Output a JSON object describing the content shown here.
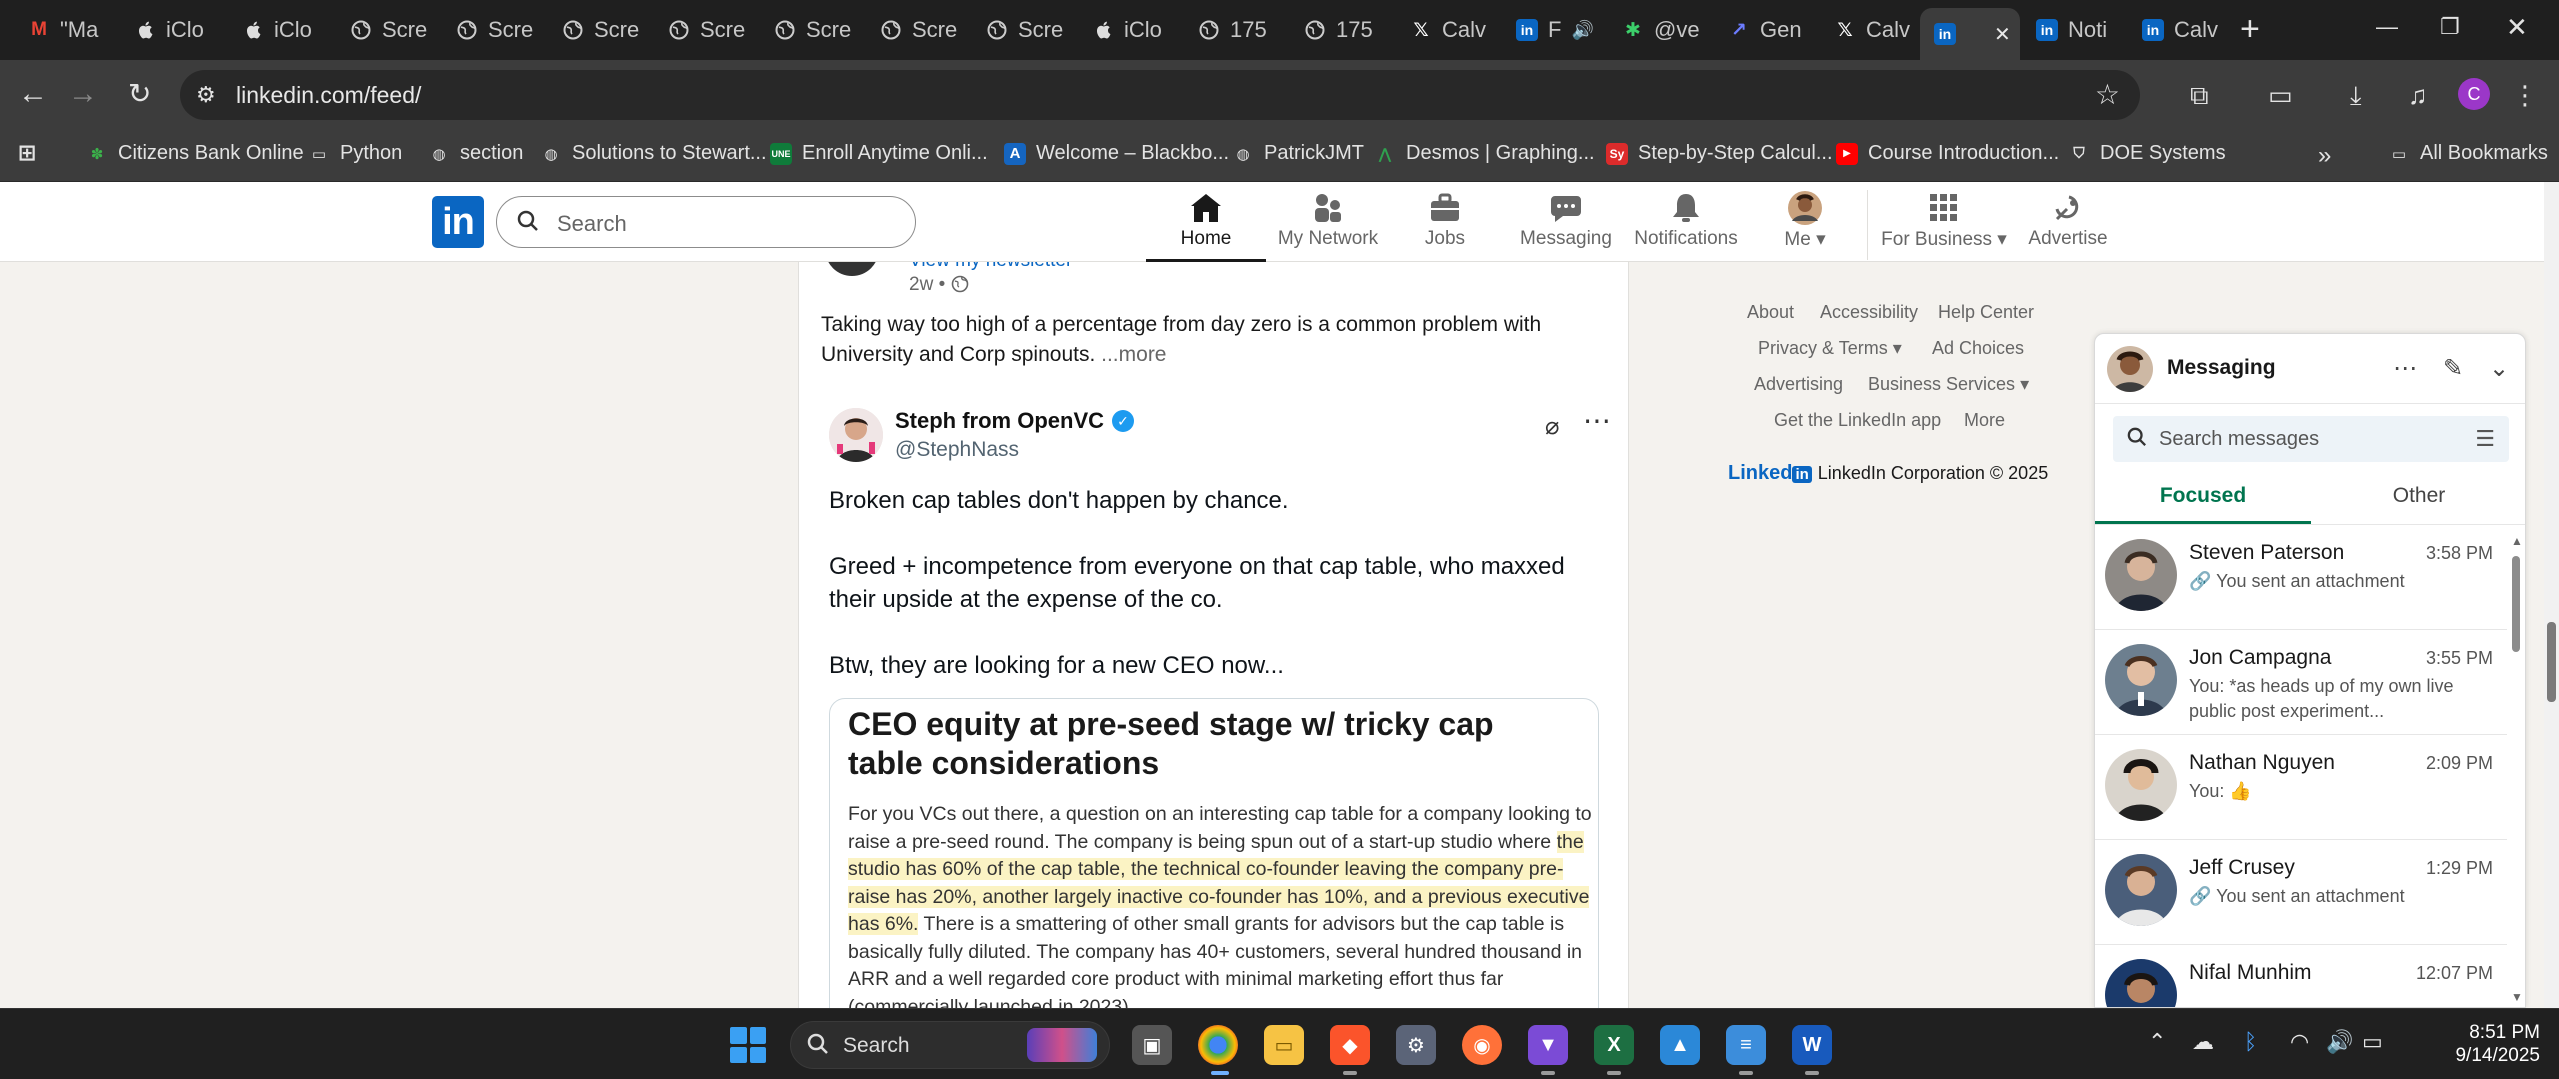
{
  "browser": {
    "tabs": [
      {
        "label": "\"Ma",
        "icon": "gmail-icon"
      },
      {
        "label": "iClo",
        "icon": "apple-icon"
      },
      {
        "label": "iClo",
        "icon": "apple-icon"
      },
      {
        "label": "Scre",
        "icon": "globe-icon"
      },
      {
        "label": "Scre",
        "icon": "globe-icon"
      },
      {
        "label": "Scre",
        "icon": "globe-icon"
      },
      {
        "label": "Scre",
        "icon": "globe-icon"
      },
      {
        "label": "Scre",
        "icon": "globe-icon"
      },
      {
        "label": "Scre",
        "icon": "globe-icon"
      },
      {
        "label": "Scre",
        "icon": "globe-icon"
      },
      {
        "label": "iClo",
        "icon": "apple-icon"
      },
      {
        "label": "175",
        "icon": "globe-icon"
      },
      {
        "label": "175",
        "icon": "globe-icon"
      },
      {
        "label": "Calv",
        "icon": "x-icon"
      },
      {
        "label": "F",
        "icon": "linkedin-icon"
      },
      {
        "label": "@ve",
        "icon": "perplexity-icon"
      },
      {
        "label": "Gen",
        "icon": "arrow-icon"
      },
      {
        "label": "Calv",
        "icon": "x-icon"
      },
      {
        "label": "",
        "icon": "linkedin-icon",
        "active": true
      },
      {
        "label": "Noti",
        "icon": "linkedin-icon"
      },
      {
        "label": "Calv",
        "icon": "linkedin-icon"
      }
    ],
    "url": "linkedin.com/feed/",
    "bookmarks": [
      "Citizens Bank Online",
      "Python",
      "section",
      "Solutions to Stewart...",
      "Enroll Anytime Onli...",
      "Welcome – Blackbo...",
      "PatrickJMT",
      "Desmos | Graphing...",
      "Step-by-Step Calcul...",
      "Course Introduction...",
      "DOE Systems"
    ],
    "all_bookmarks": "All Bookmarks",
    "profile_initial": "C"
  },
  "linkedin": {
    "logo": "in",
    "search_placeholder": "Search",
    "nav": [
      {
        "label": "Home"
      },
      {
        "label": "My Network"
      },
      {
        "label": "Jobs"
      },
      {
        "label": "Messaging"
      },
      {
        "label": "Notifications"
      },
      {
        "label": "Me"
      },
      {
        "label": "For Business"
      },
      {
        "label": "Advertise"
      }
    ]
  },
  "feed": {
    "newsletter_link": "View my newsletter",
    "time_ago": "2w •",
    "caption": "Taking way too high of a percentage from day zero is a common problem with University and Corp spinouts.",
    "more": "...more",
    "tweet": {
      "author": "Steph from OpenVC",
      "handle": "@StephNass",
      "lines": [
        "Broken cap tables don't happen by chance.",
        "Greed + incompetence from everyone on that cap table, who maxxed their upside at the expense of the co.",
        "Btw, they are looking for a new CEO now..."
      ],
      "embed_title": "CEO equity at pre-seed stage w/ tricky cap table considerations",
      "embed_text_1": "For you VCs out there, a question on an interesting cap table for a company looking to raise a pre-seed round. The company is being spun out of a start-up studio where",
      "embed_text_highlight": "the studio has 60% of the cap table, the technical co-founder leaving the company pre-raise has 20%, another largely inactive co-founder has 10%, and a previous executive has 6%.",
      "embed_text_2": "There is a smattering of other small grants for advisors but the cap table is basically fully diluted. The company has 40+ customers, several hundred thousand in ARR and a well regarded core product with minimal marketing effort thus far (commercially launched in 2023)."
    }
  },
  "footer": {
    "links": [
      "About",
      "Accessibility",
      "Help Center",
      "Privacy & Terms",
      "Ad Choices",
      "Advertising",
      "Business Services",
      "Get the LinkedIn app",
      "More"
    ],
    "brand_word": "Linked",
    "brand_in": "in",
    "copyright": "LinkedIn Corporation © 2025"
  },
  "messaging": {
    "title": "Messaging",
    "search_placeholder": "Search messages",
    "tabs": [
      "Focused",
      "Other"
    ],
    "conversations": [
      {
        "name": "Steven Paterson",
        "time": "3:58 PM",
        "preview": "You sent an attachment",
        "attachment": true
      },
      {
        "name": "Jon Campagna",
        "time": "3:55 PM",
        "preview": "You: *as heads up of my own live public post experiment..."
      },
      {
        "name": "Nathan Nguyen",
        "time": "2:09 PM",
        "preview": "You: 👍"
      },
      {
        "name": "Jeff Crusey",
        "time": "1:29 PM",
        "preview": "You sent an attachment",
        "attachment": true
      },
      {
        "name": "Nifal Munhim",
        "time": "12:07 PM",
        "preview": ""
      }
    ]
  },
  "taskbar": {
    "search_placeholder": "Search",
    "time": "8:51 PM",
    "date": "9/14/2025"
  },
  "colors": {
    "linkedin_blue": "#0a66c2",
    "messaging_green": "#01754f",
    "highlight": "#fbf3c4"
  }
}
